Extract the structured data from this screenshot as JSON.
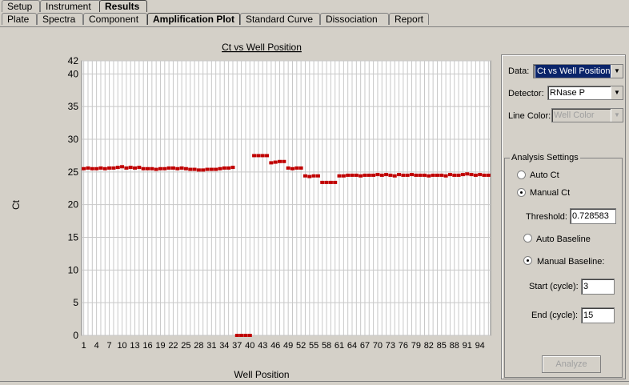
{
  "tabs_top": [
    {
      "label": "Setup"
    },
    {
      "label": "Instrument"
    },
    {
      "label": "Results"
    }
  ],
  "tabs_sub": [
    {
      "label": "Plate"
    },
    {
      "label": "Spectra"
    },
    {
      "label": "Component"
    },
    {
      "label": "Amplification Plot"
    },
    {
      "label": "Standard Curve"
    },
    {
      "label": "Dissociation"
    },
    {
      "label": "Report"
    }
  ],
  "controls": {
    "data_label": "Data:",
    "data_value": "Ct vs Well Position",
    "detector_label": "Detector:",
    "detector_value": "RNase P",
    "line_color_label": "Line Color:",
    "line_color_value": "Well Color",
    "analysis_title": "Analysis Settings",
    "auto_ct": "Auto Ct",
    "manual_ct": "Manual Ct",
    "threshold_label": "Threshold:",
    "threshold_value": "0.728583",
    "auto_baseline": "Auto Baseline",
    "manual_baseline": "Manual Baseline:",
    "start_label": "Start (cycle):",
    "start_value": "3",
    "end_label": "End (cycle):",
    "end_value": "15",
    "analyze_label": "Analyze"
  },
  "chart_data": {
    "type": "scatter",
    "title": "Ct vs Well Position",
    "xlabel": "Well Position",
    "ylabel": "Ct",
    "xlim": [
      1,
      96
    ],
    "ylim": [
      0,
      42
    ],
    "yticks": [
      0,
      5,
      10,
      15,
      20,
      25,
      30,
      35,
      40,
      42
    ],
    "xticks": [
      1,
      4,
      7,
      10,
      13,
      16,
      19,
      22,
      25,
      28,
      31,
      34,
      37,
      40,
      43,
      46,
      49,
      52,
      55,
      58,
      61,
      64,
      67,
      70,
      73,
      76,
      79,
      82,
      85,
      88,
      91,
      94
    ],
    "grid": true,
    "marker_color": "#c00000",
    "points": [
      [
        1,
        25.5
      ],
      [
        2,
        25.6
      ],
      [
        3,
        25.5
      ],
      [
        4,
        25.5
      ],
      [
        5,
        25.6
      ],
      [
        6,
        25.5
      ],
      [
        7,
        25.6
      ],
      [
        8,
        25.6
      ],
      [
        9,
        25.7
      ],
      [
        10,
        25.8
      ],
      [
        11,
        25.6
      ],
      [
        12,
        25.7
      ],
      [
        13,
        25.6
      ],
      [
        14,
        25.7
      ],
      [
        15,
        25.5
      ],
      [
        16,
        25.5
      ],
      [
        17,
        25.5
      ],
      [
        18,
        25.4
      ],
      [
        19,
        25.5
      ],
      [
        20,
        25.5
      ],
      [
        21,
        25.6
      ],
      [
        22,
        25.6
      ],
      [
        23,
        25.5
      ],
      [
        24,
        25.6
      ],
      [
        25,
        25.5
      ],
      [
        26,
        25.4
      ],
      [
        27,
        25.4
      ],
      [
        28,
        25.3
      ],
      [
        29,
        25.3
      ],
      [
        30,
        25.4
      ],
      [
        31,
        25.4
      ],
      [
        32,
        25.4
      ],
      [
        33,
        25.5
      ],
      [
        34,
        25.6
      ],
      [
        35,
        25.6
      ],
      [
        36,
        25.7
      ],
      [
        37,
        0
      ],
      [
        38,
        0
      ],
      [
        39,
        0
      ],
      [
        40,
        0
      ],
      [
        41,
        27.5
      ],
      [
        42,
        27.5
      ],
      [
        43,
        27.5
      ],
      [
        44,
        27.5
      ],
      [
        45,
        26.4
      ],
      [
        46,
        26.5
      ],
      [
        47,
        26.6
      ],
      [
        48,
        26.6
      ],
      [
        49,
        25.6
      ],
      [
        50,
        25.5
      ],
      [
        51,
        25.6
      ],
      [
        52,
        25.6
      ],
      [
        53,
        24.4
      ],
      [
        54,
        24.3
      ],
      [
        55,
        24.4
      ],
      [
        56,
        24.4
      ],
      [
        57,
        23.4
      ],
      [
        58,
        23.4
      ],
      [
        59,
        23.4
      ],
      [
        60,
        23.4
      ],
      [
        61,
        24.4
      ],
      [
        62,
        24.4
      ],
      [
        63,
        24.5
      ],
      [
        64,
        24.5
      ],
      [
        65,
        24.5
      ],
      [
        66,
        24.4
      ],
      [
        67,
        24.5
      ],
      [
        68,
        24.5
      ],
      [
        69,
        24.5
      ],
      [
        70,
        24.6
      ],
      [
        71,
        24.5
      ],
      [
        72,
        24.6
      ],
      [
        73,
        24.5
      ],
      [
        74,
        24.4
      ],
      [
        75,
        24.6
      ],
      [
        76,
        24.5
      ],
      [
        77,
        24.5
      ],
      [
        78,
        24.6
      ],
      [
        79,
        24.5
      ],
      [
        80,
        24.5
      ],
      [
        81,
        24.5
      ],
      [
        82,
        24.4
      ],
      [
        83,
        24.5
      ],
      [
        84,
        24.5
      ],
      [
        85,
        24.5
      ],
      [
        86,
        24.4
      ],
      [
        87,
        24.6
      ],
      [
        88,
        24.5
      ],
      [
        89,
        24.5
      ],
      [
        90,
        24.6
      ],
      [
        91,
        24.7
      ],
      [
        92,
        24.6
      ],
      [
        93,
        24.5
      ],
      [
        94,
        24.6
      ],
      [
        95,
        24.5
      ],
      [
        96,
        24.5
      ]
    ]
  }
}
